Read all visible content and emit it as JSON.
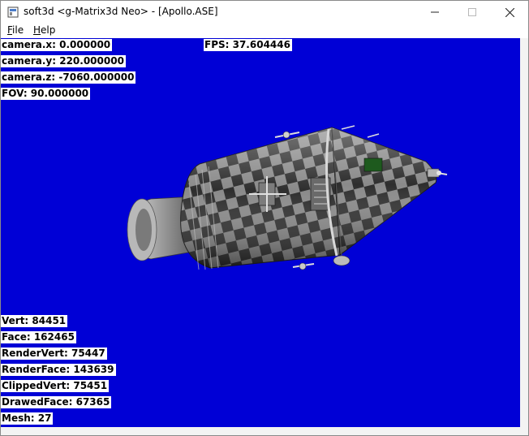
{
  "window": {
    "title": "soft3d <g-Matrix3d Neo> - [Apollo.ASE]",
    "icon": "app-icon",
    "controls": [
      "minimize-icon",
      "maximize-icon",
      "close-icon"
    ]
  },
  "menu": {
    "file": {
      "accel": "F",
      "rest": "ile"
    },
    "help": {
      "accel": "H",
      "rest": "elp"
    }
  },
  "hud_top": {
    "camera_x": "camera.x: 0.000000",
    "camera_y": "camera.y: 220.000000",
    "camera_z": "camera.z: -7060.000000",
    "fov": "FOV: 90.000000",
    "fps": "FPS: 37.604446"
  },
  "hud_bottom": {
    "vert": "Vert: 84451",
    "face": "Face: 162465",
    "render_vert": "RenderVert: 75447",
    "render_face": "RenderFace: 143639",
    "clipped_vert": "ClippedVert: 75451",
    "drawed_face": "DrawedFace: 67365",
    "mesh": "Mesh: 27"
  },
  "colors": {
    "viewport_bg": "#0000d6",
    "hud_bg": "#ffffff",
    "hud_text": "#000000"
  }
}
